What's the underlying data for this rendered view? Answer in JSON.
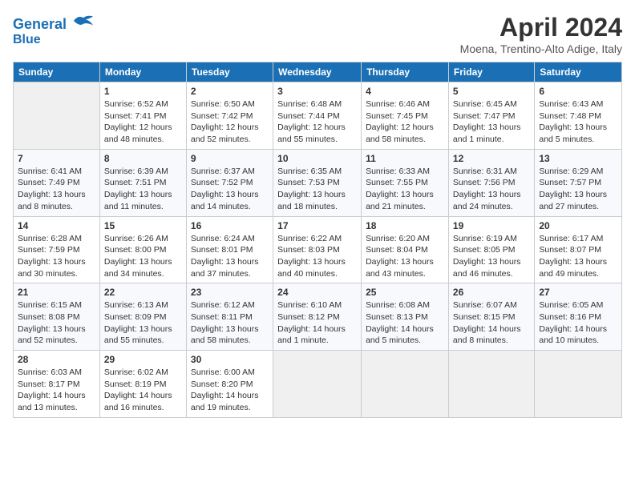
{
  "header": {
    "logo_line1": "General",
    "logo_line2": "Blue",
    "main_title": "April 2024",
    "subtitle": "Moena, Trentino-Alto Adige, Italy"
  },
  "columns": [
    "Sunday",
    "Monday",
    "Tuesday",
    "Wednesday",
    "Thursday",
    "Friday",
    "Saturday"
  ],
  "weeks": [
    [
      {
        "day": "",
        "info": ""
      },
      {
        "day": "1",
        "info": "Sunrise: 6:52 AM\nSunset: 7:41 PM\nDaylight: 12 hours\nand 48 minutes."
      },
      {
        "day": "2",
        "info": "Sunrise: 6:50 AM\nSunset: 7:42 PM\nDaylight: 12 hours\nand 52 minutes."
      },
      {
        "day": "3",
        "info": "Sunrise: 6:48 AM\nSunset: 7:44 PM\nDaylight: 12 hours\nand 55 minutes."
      },
      {
        "day": "4",
        "info": "Sunrise: 6:46 AM\nSunset: 7:45 PM\nDaylight: 12 hours\nand 58 minutes."
      },
      {
        "day": "5",
        "info": "Sunrise: 6:45 AM\nSunset: 7:47 PM\nDaylight: 13 hours\nand 1 minute."
      },
      {
        "day": "6",
        "info": "Sunrise: 6:43 AM\nSunset: 7:48 PM\nDaylight: 13 hours\nand 5 minutes."
      }
    ],
    [
      {
        "day": "7",
        "info": "Sunrise: 6:41 AM\nSunset: 7:49 PM\nDaylight: 13 hours\nand 8 minutes."
      },
      {
        "day": "8",
        "info": "Sunrise: 6:39 AM\nSunset: 7:51 PM\nDaylight: 13 hours\nand 11 minutes."
      },
      {
        "day": "9",
        "info": "Sunrise: 6:37 AM\nSunset: 7:52 PM\nDaylight: 13 hours\nand 14 minutes."
      },
      {
        "day": "10",
        "info": "Sunrise: 6:35 AM\nSunset: 7:53 PM\nDaylight: 13 hours\nand 18 minutes."
      },
      {
        "day": "11",
        "info": "Sunrise: 6:33 AM\nSunset: 7:55 PM\nDaylight: 13 hours\nand 21 minutes."
      },
      {
        "day": "12",
        "info": "Sunrise: 6:31 AM\nSunset: 7:56 PM\nDaylight: 13 hours\nand 24 minutes."
      },
      {
        "day": "13",
        "info": "Sunrise: 6:29 AM\nSunset: 7:57 PM\nDaylight: 13 hours\nand 27 minutes."
      }
    ],
    [
      {
        "day": "14",
        "info": "Sunrise: 6:28 AM\nSunset: 7:59 PM\nDaylight: 13 hours\nand 30 minutes."
      },
      {
        "day": "15",
        "info": "Sunrise: 6:26 AM\nSunset: 8:00 PM\nDaylight: 13 hours\nand 34 minutes."
      },
      {
        "day": "16",
        "info": "Sunrise: 6:24 AM\nSunset: 8:01 PM\nDaylight: 13 hours\nand 37 minutes."
      },
      {
        "day": "17",
        "info": "Sunrise: 6:22 AM\nSunset: 8:03 PM\nDaylight: 13 hours\nand 40 minutes."
      },
      {
        "day": "18",
        "info": "Sunrise: 6:20 AM\nSunset: 8:04 PM\nDaylight: 13 hours\nand 43 minutes."
      },
      {
        "day": "19",
        "info": "Sunrise: 6:19 AM\nSunset: 8:05 PM\nDaylight: 13 hours\nand 46 minutes."
      },
      {
        "day": "20",
        "info": "Sunrise: 6:17 AM\nSunset: 8:07 PM\nDaylight: 13 hours\nand 49 minutes."
      }
    ],
    [
      {
        "day": "21",
        "info": "Sunrise: 6:15 AM\nSunset: 8:08 PM\nDaylight: 13 hours\nand 52 minutes."
      },
      {
        "day": "22",
        "info": "Sunrise: 6:13 AM\nSunset: 8:09 PM\nDaylight: 13 hours\nand 55 minutes."
      },
      {
        "day": "23",
        "info": "Sunrise: 6:12 AM\nSunset: 8:11 PM\nDaylight: 13 hours\nand 58 minutes."
      },
      {
        "day": "24",
        "info": "Sunrise: 6:10 AM\nSunset: 8:12 PM\nDaylight: 14 hours\nand 1 minute."
      },
      {
        "day": "25",
        "info": "Sunrise: 6:08 AM\nSunset: 8:13 PM\nDaylight: 14 hours\nand 5 minutes."
      },
      {
        "day": "26",
        "info": "Sunrise: 6:07 AM\nSunset: 8:15 PM\nDaylight: 14 hours\nand 8 minutes."
      },
      {
        "day": "27",
        "info": "Sunrise: 6:05 AM\nSunset: 8:16 PM\nDaylight: 14 hours\nand 10 minutes."
      }
    ],
    [
      {
        "day": "28",
        "info": "Sunrise: 6:03 AM\nSunset: 8:17 PM\nDaylight: 14 hours\nand 13 minutes."
      },
      {
        "day": "29",
        "info": "Sunrise: 6:02 AM\nSunset: 8:19 PM\nDaylight: 14 hours\nand 16 minutes."
      },
      {
        "day": "30",
        "info": "Sunrise: 6:00 AM\nSunset: 8:20 PM\nDaylight: 14 hours\nand 19 minutes."
      },
      {
        "day": "",
        "info": ""
      },
      {
        "day": "",
        "info": ""
      },
      {
        "day": "",
        "info": ""
      },
      {
        "day": "",
        "info": ""
      }
    ]
  ]
}
